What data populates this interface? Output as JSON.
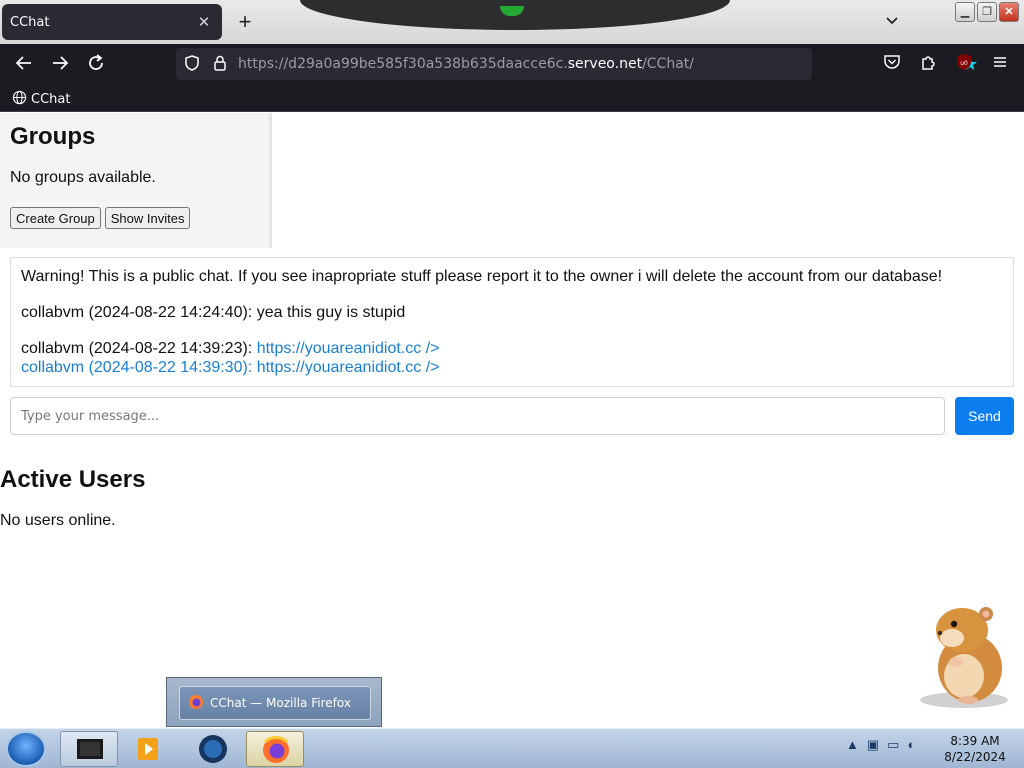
{
  "browser": {
    "tab_title": "CChat",
    "tab_close": "✕",
    "new_tab": "+",
    "url_prefix": "https://d29a0a99be585f30a538b635daacce6c.",
    "url_host": "serveo.net",
    "url_suffix": "/CChat/",
    "bookmark_label": "CChat"
  },
  "sidebar": {
    "title": "Groups",
    "empty_text": "No groups available.",
    "create_button": "Create Group",
    "invites_button": "Show Invites"
  },
  "chat": {
    "warning": "Warning! This is a public chat. If you see inapropriate stuff please report it to the owner i will delete the account from our database!",
    "messages": [
      {
        "author_ts": "collabvm (2024-08-22 14:24:40): ",
        "text": "yea this guy is stupid"
      },
      {
        "author_ts": "collabvm (2024-08-22 14:39:23): ",
        "link": "https://youareanidiot.cc />"
      },
      {
        "author_ts": "collabvm (2024-08-22 14:39:30): ",
        "link": "https://youareanidiot.cc />"
      }
    ],
    "input_placeholder": "Type your message...",
    "send_button": "Send"
  },
  "active_users": {
    "title": "Active Users",
    "empty_text": "No users online."
  },
  "taskbar": {
    "popup_label": "CChat — Mozilla Firefox",
    "clock_time": "8:39 AM",
    "clock_date": "8/22/2024"
  },
  "colors": {
    "accent": "#0b7dee",
    "link": "#1a7fd1",
    "toolbar": "#1c1b22"
  }
}
